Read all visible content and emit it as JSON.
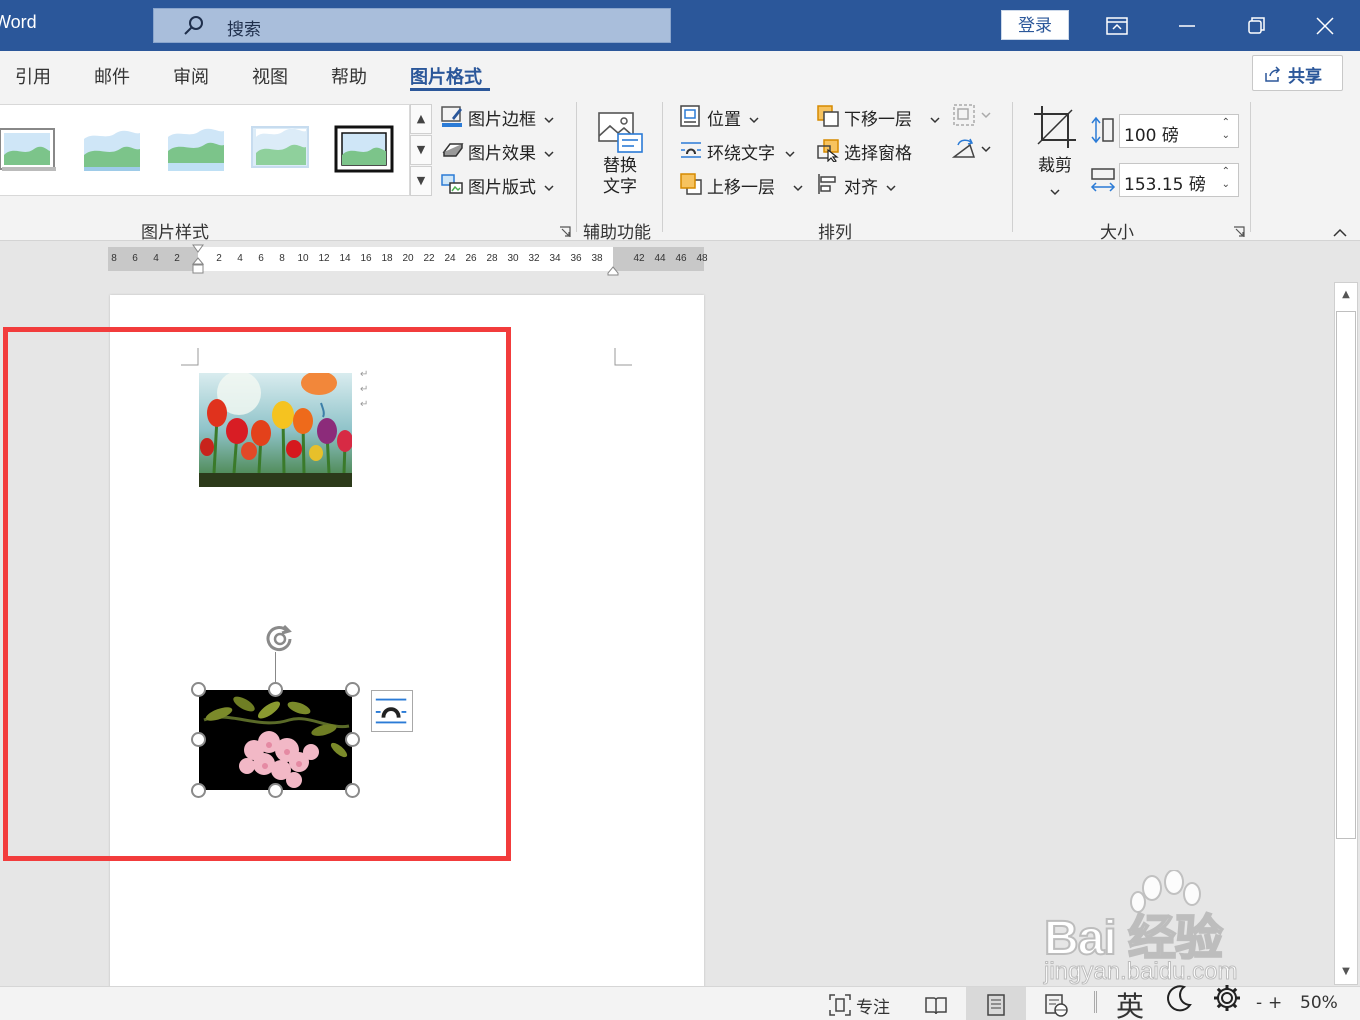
{
  "titlebar": {
    "app_name": "Word",
    "search_label": "搜索",
    "login_label": "登录"
  },
  "tabs": [
    {
      "label": "引用"
    },
    {
      "label": "邮件"
    },
    {
      "label": "审阅"
    },
    {
      "label": "视图"
    },
    {
      "label": "帮助"
    },
    {
      "label": "图片格式",
      "active": true
    }
  ],
  "share_label": "共享",
  "ribbon": {
    "picture_styles": {
      "border": "图片边框",
      "effects": "图片效果",
      "layout": "图片版式",
      "group_label": "图片样式"
    },
    "accessibility": {
      "alt_text_line1": "替换",
      "alt_text_line2": "文字",
      "group_label": "辅助功能"
    },
    "arrange": {
      "position": "位置",
      "wrap_text": "环绕文字",
      "bring_forward": "上移一层",
      "send_backward": "下移一层",
      "selection_pane": "选择窗格",
      "align": "对齐",
      "group_label": "排列"
    },
    "size": {
      "crop": "裁剪",
      "height": "100 磅",
      "width": "153.15 磅",
      "group_label": "大小"
    }
  },
  "ruler_left": [
    "8",
    "6",
    "4",
    "2"
  ],
  "ruler_right": [
    "2",
    "4",
    "6",
    "8",
    "10",
    "12",
    "14",
    "16",
    "18",
    "20",
    "22",
    "24",
    "26",
    "28",
    "30",
    "32",
    "34",
    "36",
    "38",
    "42",
    "44",
    "46",
    "48"
  ],
  "statusbar": {
    "focus": "专注",
    "ime": "英",
    "zoom_minus": "-",
    "zoom_plus": "+",
    "zoom": "50%"
  },
  "watermark": {
    "line1": "Bai 经验",
    "line2": "jingyan.baidu.com"
  },
  "colors": {
    "brand": "#2b579a",
    "highlight_frame": "#f23c3c"
  }
}
